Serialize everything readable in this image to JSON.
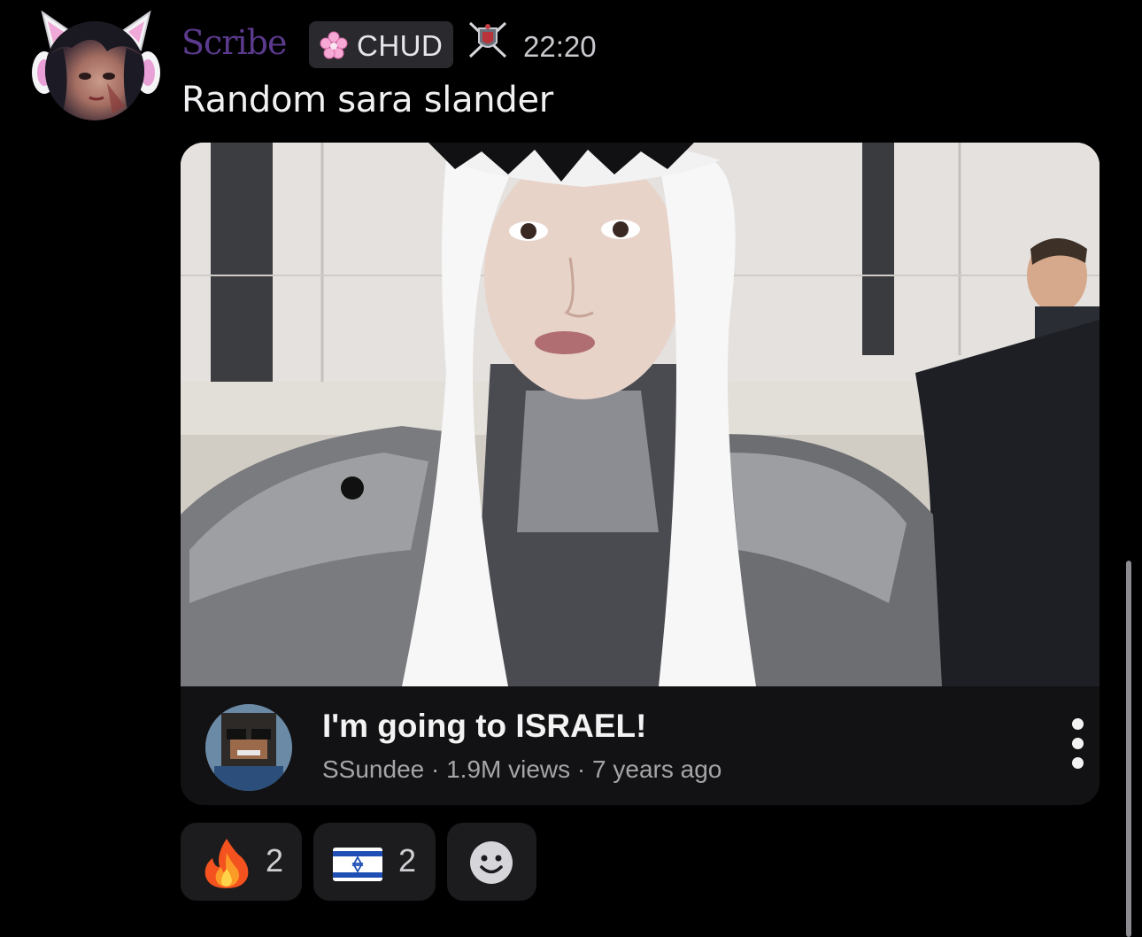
{
  "message": {
    "username": "Scribe",
    "role": {
      "label": "CHUD",
      "icon": "cherry-blossom-icon"
    },
    "badge_icon": "crossed-swords-crest-icon",
    "timestamp": "22:20",
    "text": "Random sara slander"
  },
  "embed": {
    "video": {
      "title": "I'm going to ISRAEL!",
      "channel": "SSundee",
      "views": "1.9M views",
      "age": "7 years ago",
      "separator": " · "
    }
  },
  "reactions": [
    {
      "emoji": "fire-emoji",
      "count": "2"
    },
    {
      "emoji": "israel-flag-emoji",
      "count": "2"
    },
    {
      "emoji": "add-reaction-icon"
    }
  ],
  "colors": {
    "username": "#5b3a8e",
    "background": "#000000",
    "embed_bg": "#121214",
    "reaction_bg": "#1c1c1f"
  }
}
